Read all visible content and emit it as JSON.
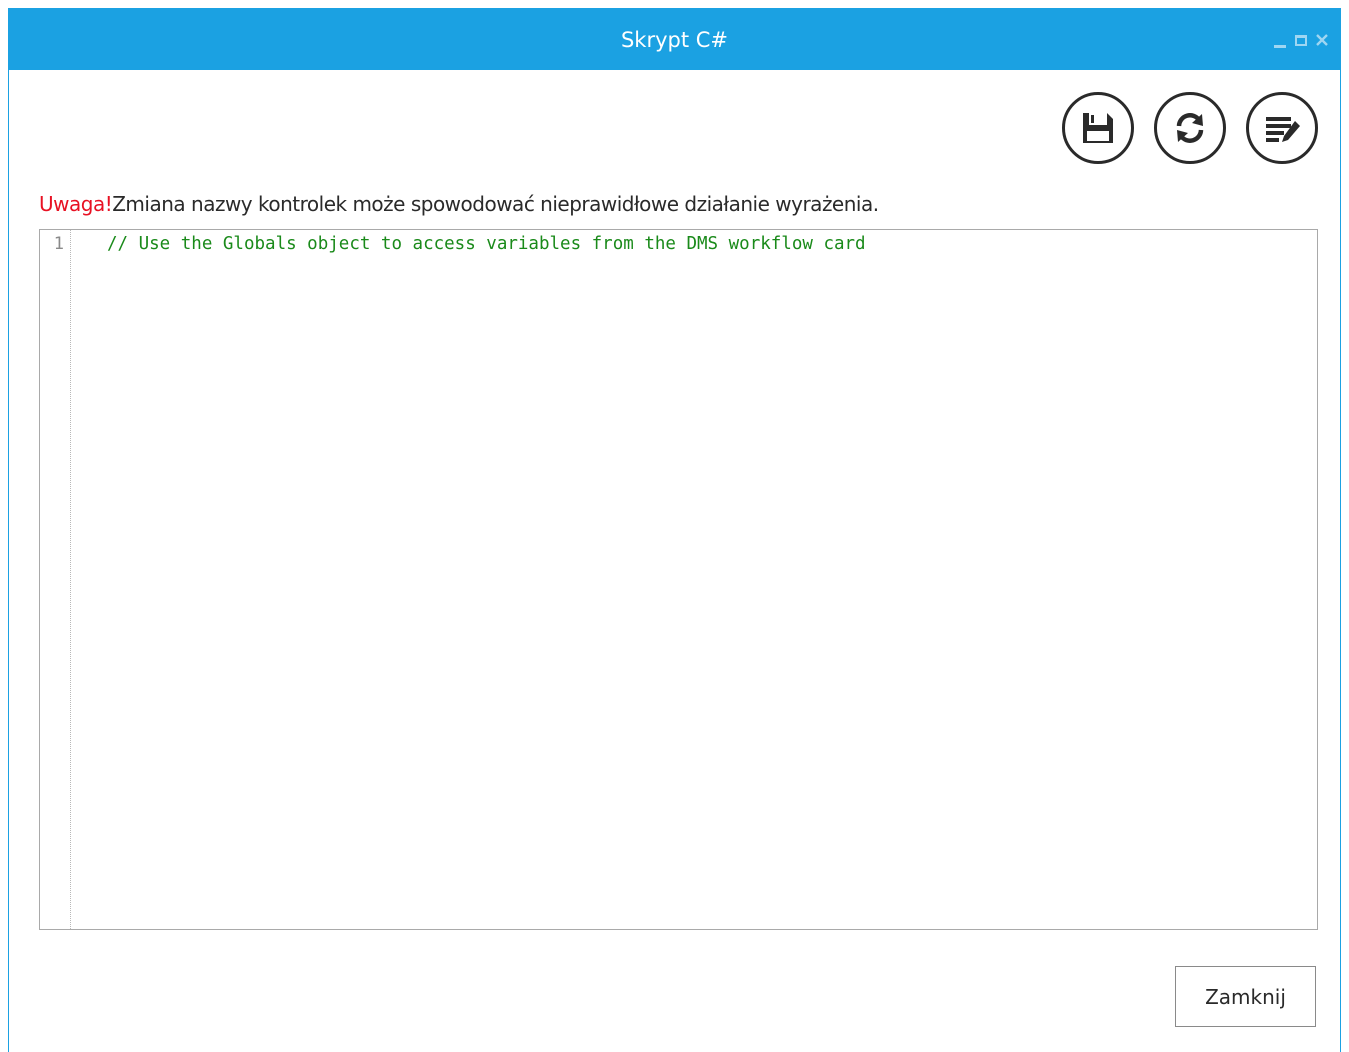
{
  "window": {
    "title": "Skrypt C#"
  },
  "toolbar": {
    "buttons": [
      {
        "icon": "save-icon"
      },
      {
        "icon": "refresh-icon"
      },
      {
        "icon": "edit-list-icon"
      }
    ]
  },
  "warning": {
    "label": "Uwaga!",
    "message": "Zmiana nazwy kontrolek może spowodować nieprawidłowe działanie wyrażenia."
  },
  "editor": {
    "lines": [
      {
        "number": "1",
        "text": "// Use the Globals object to access variables from the DMS workflow card"
      }
    ]
  },
  "footer": {
    "close_label": "Zamknij"
  },
  "colors": {
    "titlebar": "#1ba1e2",
    "warning": "#e81123",
    "comment": "#1a8a1a"
  }
}
